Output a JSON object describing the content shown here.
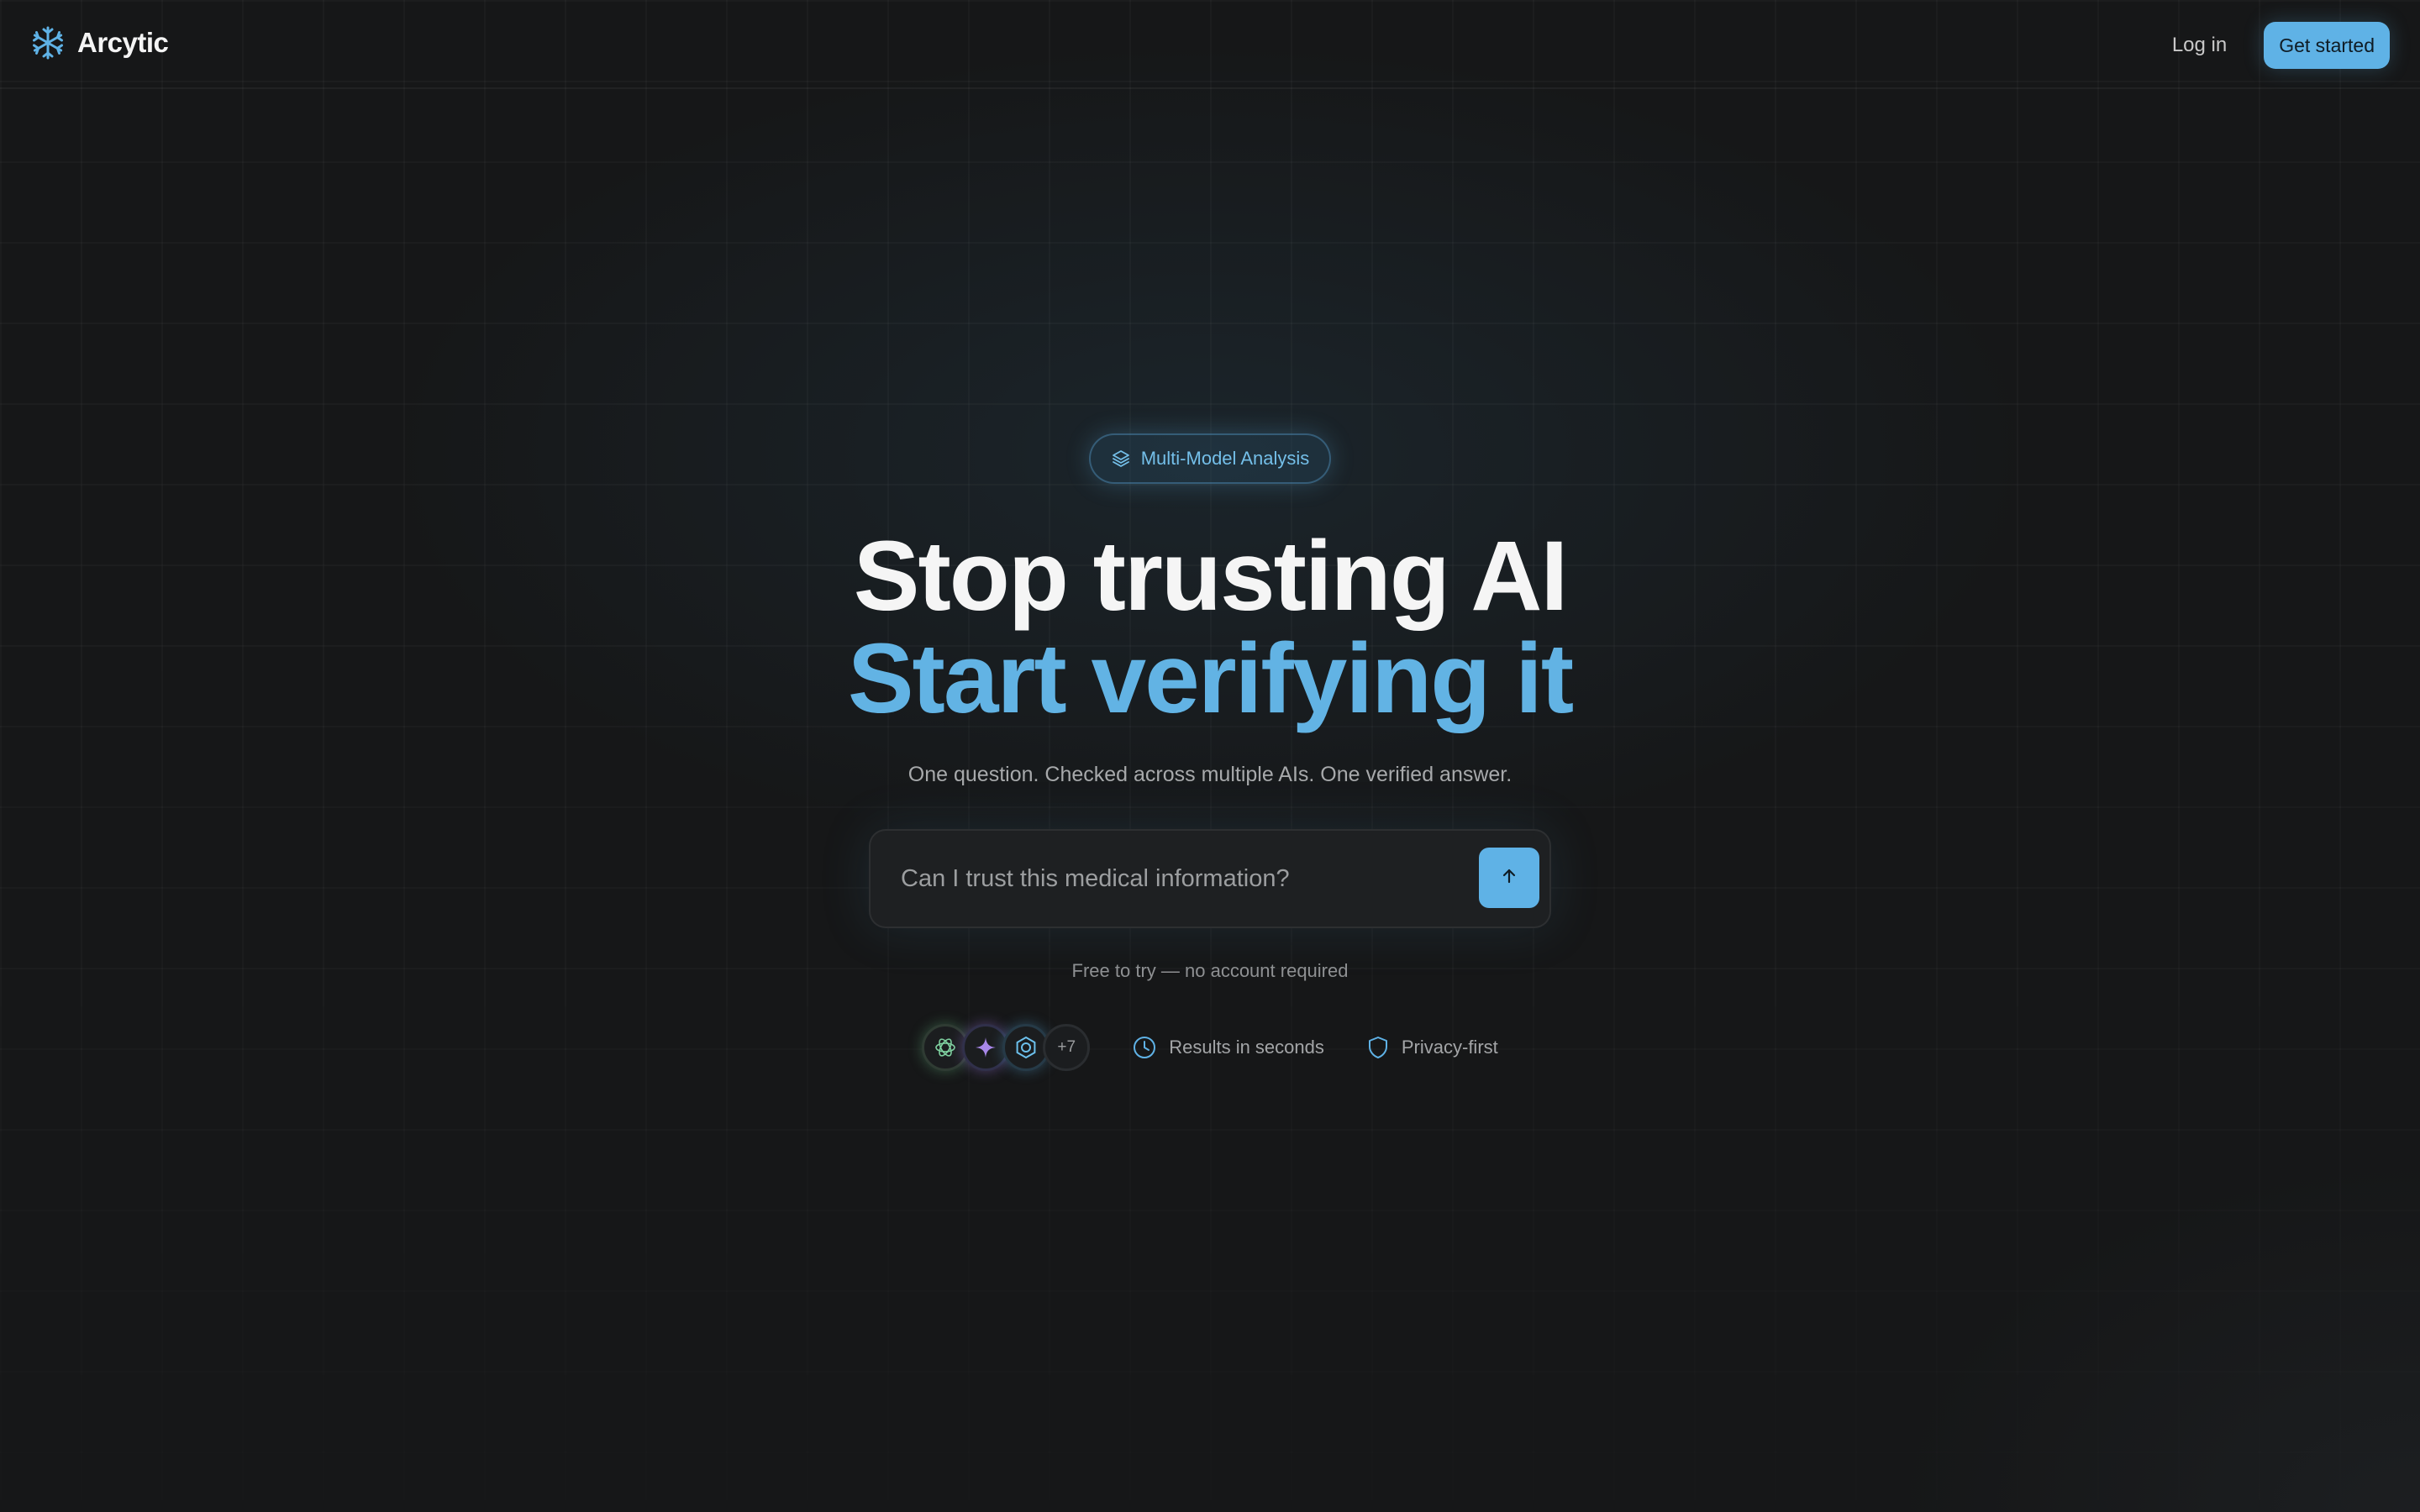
{
  "brand": {
    "name": "Arcytic",
    "logo_icon": "snowflake-icon",
    "accent_color": "#5fb2e6"
  },
  "nav": {
    "login_label": "Log in",
    "cta_label": "Get started"
  },
  "hero": {
    "badge_label": "Multi-Model Analysis",
    "badge_icon": "layers-icon",
    "title_line1": "Stop trusting AI",
    "title_line2": "Start verifying it",
    "subtitle": "One question. Checked across multiple AIs. One verified answer.",
    "search_placeholder": "Can I trust this medical information?",
    "submit_icon": "arrow-up-icon",
    "free_note": "Free to try — no account required"
  },
  "trust": {
    "model_icons": [
      "openai-icon",
      "gemini-sparkle-icon",
      "hexagon-model-icon"
    ],
    "more_models_label": "+7",
    "features": [
      {
        "icon": "clock-icon",
        "label": "Results in seconds"
      },
      {
        "icon": "shield-icon",
        "label": "Privacy-first"
      }
    ]
  }
}
